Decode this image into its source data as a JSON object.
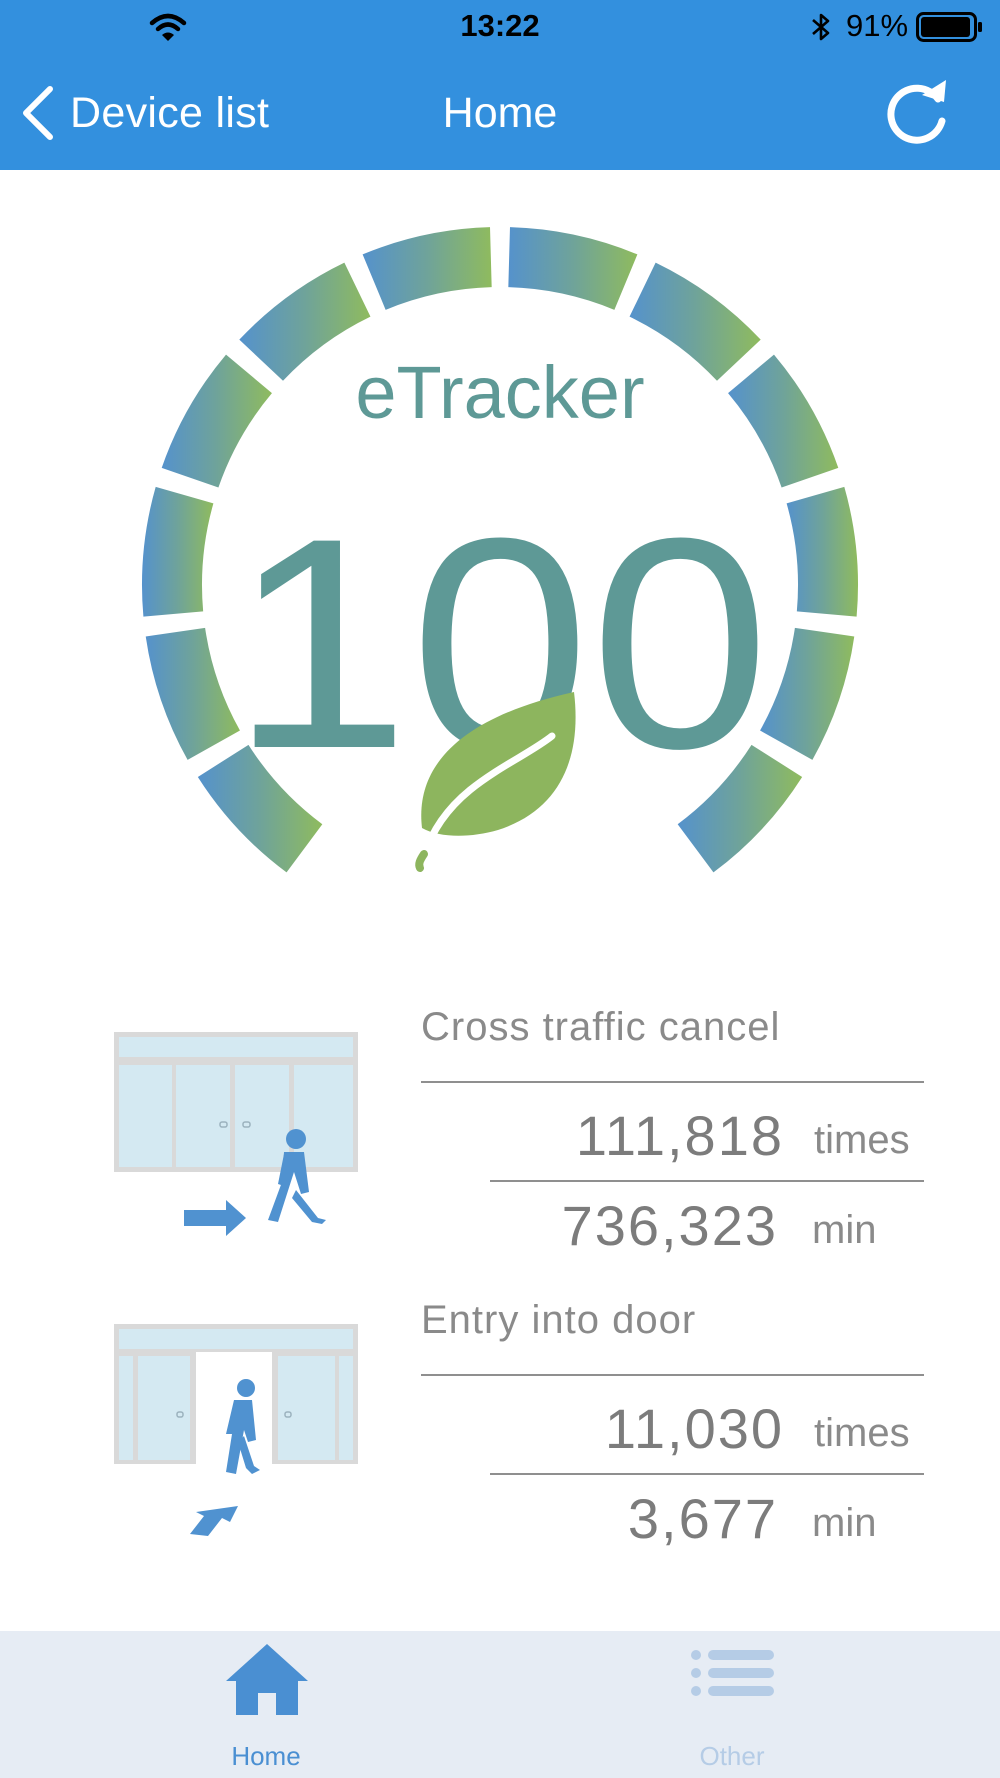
{
  "status_bar": {
    "time": "13:22",
    "battery_percent": "91%",
    "wifi_icon": "wifi-icon",
    "bluetooth_icon": "bluetooth-icon",
    "battery_icon": "battery-icon"
  },
  "nav": {
    "back_label": "Device list",
    "title": "Home",
    "back_icon": "chevron-left-icon",
    "refresh_icon": "refresh-icon"
  },
  "gauge": {
    "brand": "eTracker",
    "score": "100",
    "segments_lit": 12,
    "segments_total": 12,
    "emblem_icon": "leaf-icon",
    "color_start": "#5592CC",
    "color_end": "#8FBB5E",
    "text_color": "#5E9996"
  },
  "metrics": [
    {
      "label": "Cross traffic cancel",
      "icon": "cross-traffic-door-icon",
      "count": "111,818",
      "count_unit": "times",
      "duration": "736,323",
      "duration_unit": "min"
    },
    {
      "label": "Entry into door",
      "icon": "entry-door-icon",
      "count": "11,030",
      "count_unit": "times",
      "duration": "3,677",
      "duration_unit": "min"
    }
  ],
  "tab_bar": {
    "tabs": [
      {
        "label": "Home",
        "icon": "home-icon",
        "active": true
      },
      {
        "label": "Other",
        "icon": "list-icon",
        "active": false
      }
    ]
  }
}
